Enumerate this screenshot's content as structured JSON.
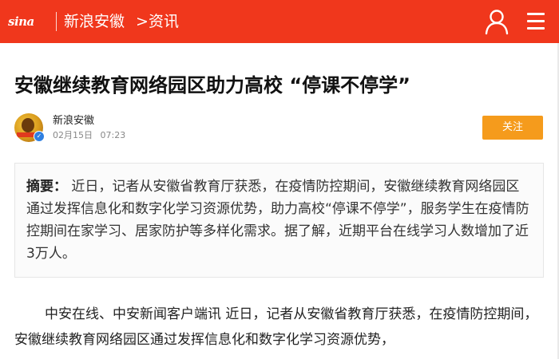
{
  "header": {
    "logo_text": "sina",
    "site_name": "新浪安徽",
    "breadcrumb_arrow": ">",
    "section": "资讯",
    "brand_color": "#f0371c",
    "icons": [
      "user-icon",
      "menu-icon"
    ]
  },
  "article": {
    "title": "安徽继续教育网络园区助力高校 “停课不停学”",
    "author": "新浪安徽",
    "date": "02月15日",
    "time": "07:23",
    "follow_label": "关注",
    "follow_color": "#f59b1c",
    "summary_label": "摘要：",
    "summary": "近日，记者从安徽省教育厅获悉，在疫情防控期间，安徽继续教育网络园区通过发挥信息化和数字化学习资源优势，助力高校“停课不停学”，服务学生在疫情防控期间在家学习、居家防护等多样化需求。据了解，近期平台在线学习人数增加了近3万人。",
    "body": "中安在线、中安新闻客户端讯 近日，记者从安徽省教育厅获悉，在疫情防控期间，安徽继续教育网络园区通过发挥信息化和数字化学习资源优势，"
  }
}
